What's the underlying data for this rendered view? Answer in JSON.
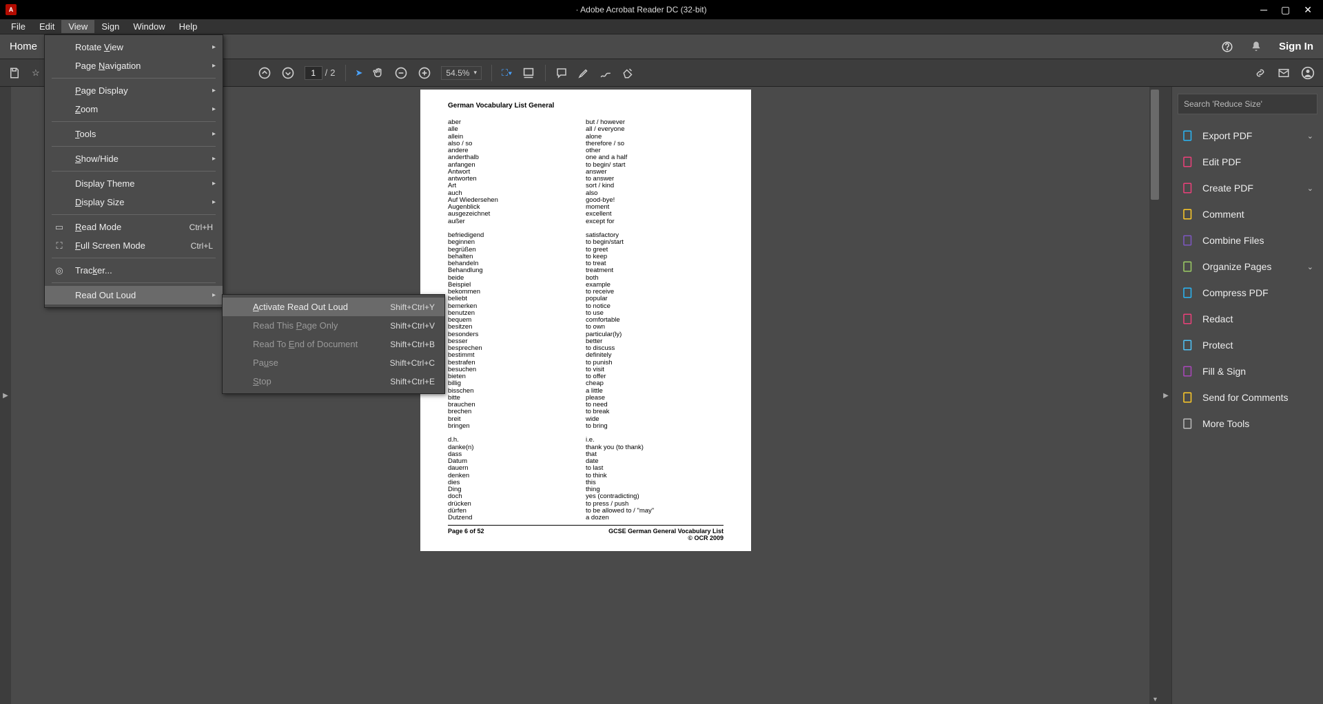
{
  "title": "· Adobe Acrobat Reader DC (32-bit)",
  "menubar": [
    "File",
    "Edit",
    "View",
    "Sign",
    "Window",
    "Help"
  ],
  "tabbar": {
    "home": "Home",
    "signin": "Sign In"
  },
  "toolbar": {
    "page_current": "1",
    "page_sep": "/",
    "page_total": "2",
    "zoom": "54.5%"
  },
  "viewmenu": {
    "rotate": "Rotate View",
    "pagenav": "Page Navigation",
    "pagedisp": "Page Display",
    "zoom": "Zoom",
    "tools": "Tools",
    "showhide": "Show/Hide",
    "dtheme": "Display Theme",
    "dsize": "Display Size",
    "readmode": "Read Mode",
    "readmode_s": "Ctrl+H",
    "fullscreen": "Full Screen Mode",
    "fullscreen_s": "Ctrl+L",
    "tracker": "Tracker...",
    "readout": "Read Out Loud"
  },
  "submenu": {
    "activate": "Activate Read Out Loud",
    "activate_s": "Shift+Ctrl+Y",
    "thispage": "Read This Page Only",
    "thispage_s": "Shift+Ctrl+V",
    "toend": "Read To End of Document",
    "toend_s": "Shift+Ctrl+B",
    "pause": "Pause",
    "pause_s": "Shift+Ctrl+C",
    "stop": "Stop",
    "stop_s": "Shift+Ctrl+E"
  },
  "rpanel": {
    "search_ph": "Search 'Reduce Size'",
    "items": [
      {
        "label": "Export PDF",
        "chev": true,
        "color": "#29b6f6"
      },
      {
        "label": "Edit PDF",
        "chev": false,
        "color": "#ec407a"
      },
      {
        "label": "Create PDF",
        "chev": true,
        "color": "#ec407a"
      },
      {
        "label": "Comment",
        "chev": false,
        "color": "#ffca28"
      },
      {
        "label": "Combine Files",
        "chev": false,
        "color": "#7e57c2"
      },
      {
        "label": "Organize Pages",
        "chev": true,
        "color": "#9ccc65"
      },
      {
        "label": "Compress PDF",
        "chev": false,
        "color": "#29b6f6"
      },
      {
        "label": "Redact",
        "chev": false,
        "color": "#ec407a"
      },
      {
        "label": "Protect",
        "chev": false,
        "color": "#4fc3f7"
      },
      {
        "label": "Fill & Sign",
        "chev": false,
        "color": "#ab47bc"
      },
      {
        "label": "Send for Comments",
        "chev": false,
        "color": "#ffca28"
      },
      {
        "label": "More Tools",
        "chev": false,
        "color": "#bbb"
      }
    ]
  },
  "doc": {
    "heading": "German Vocabulary List General",
    "left1": [
      "aber",
      "alle",
      "allein",
      "also / so",
      "andere",
      "anderthalb",
      "anfangen",
      "Antwort",
      "antworten",
      "Art",
      "auch",
      "Auf Wiedersehen",
      "Augenblick",
      "ausgezeichnet",
      "außer"
    ],
    "right1": [
      "but / however",
      "all / everyone",
      "alone",
      "therefore / so",
      "other",
      "one and a half",
      "to begin/ start",
      "answer",
      "to answer",
      "sort / kind",
      "also",
      "good-bye!",
      "moment",
      "excellent",
      "except for"
    ],
    "left2": [
      "befriedigend",
      "beginnen",
      "begrüßen",
      "behalten",
      "behandeln",
      "Behandlung",
      "beide",
      "Beispiel",
      "bekommen",
      "beliebt",
      "bemerken",
      "benutzen",
      "bequem",
      "besitzen",
      "besonders",
      "besser",
      "besprechen",
      "bestimmt",
      "bestrafen",
      "besuchen",
      "bieten",
      "billig",
      "bisschen",
      "bitte",
      "brauchen",
      "brechen",
      "breit",
      "bringen"
    ],
    "right2": [
      "satisfactory",
      "to begin/start",
      "to greet",
      "to keep",
      "to treat",
      "treatment",
      "both",
      "example",
      "to receive",
      "popular",
      "to notice",
      "to use",
      "comfortable",
      "to own",
      "particular(ly)",
      "better",
      "to discuss",
      "definitely",
      "to punish",
      "to visit",
      "to offer",
      "cheap",
      "a little",
      "please",
      "to need",
      "to break",
      "wide",
      "to bring"
    ],
    "left3": [
      "d.h.",
      "danke(n)",
      "dass",
      "Datum",
      "dauern",
      "denken",
      "dies",
      "Ding",
      "doch",
      "drücken",
      "dürfen",
      "Dutzend"
    ],
    "right3": [
      "i.e.",
      "thank you (to thank)",
      "that",
      "date",
      "to last",
      "to think",
      "this",
      "thing",
      "yes (contradicting)",
      "to press / push",
      "to be allowed to / \"may\"",
      "a dozen"
    ],
    "foot_l": "Page 6 of 52",
    "foot_r1": "GCSE German General Vocabulary List",
    "foot_r2": "© OCR 2009"
  }
}
